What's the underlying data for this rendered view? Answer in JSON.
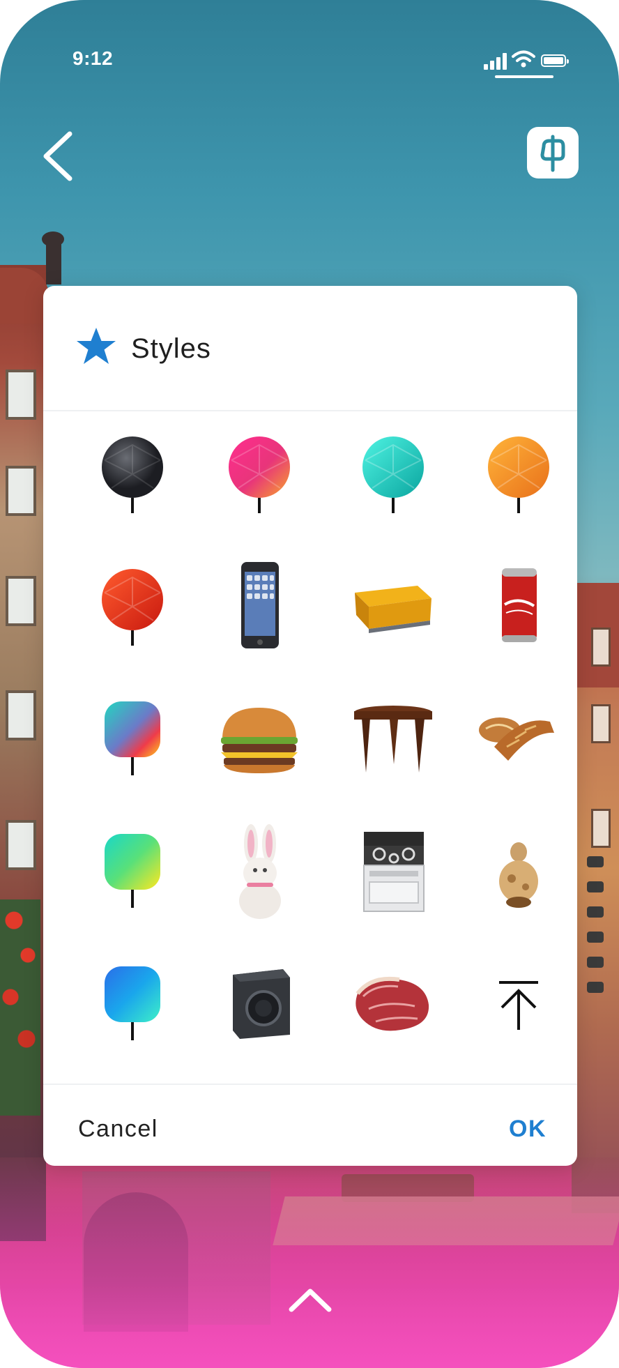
{
  "status_bar": {
    "time": "9:12"
  },
  "nav": {
    "back_icon": "chevron-left-icon",
    "brand_icon": "app-logo-icon"
  },
  "dialog": {
    "title": "Styles",
    "title_icon": "star-icon",
    "accent_color": "#1f7fd0",
    "cancel_label": "Cancel",
    "ok_label": "OK",
    "items": [
      {
        "name": "black-geo-pin"
      },
      {
        "name": "magenta-geo-pin"
      },
      {
        "name": "teal-geo-pin"
      },
      {
        "name": "orange-geo-pin"
      },
      {
        "name": "red-geo-pin"
      },
      {
        "name": "smartphone"
      },
      {
        "name": "yellow-sofa"
      },
      {
        "name": "soda-can"
      },
      {
        "name": "teal-orange-gradient-pin"
      },
      {
        "name": "burger"
      },
      {
        "name": "wooden-stool"
      },
      {
        "name": "pastries"
      },
      {
        "name": "teal-yellow-gradient-pin"
      },
      {
        "name": "bunny"
      },
      {
        "name": "stove"
      },
      {
        "name": "figurine"
      },
      {
        "name": "blue-gradient-pin"
      },
      {
        "name": "washing-machine"
      },
      {
        "name": "steak"
      },
      {
        "name": "upload-arrow"
      }
    ]
  },
  "bottom": {
    "icon": "chevron-up-icon"
  }
}
